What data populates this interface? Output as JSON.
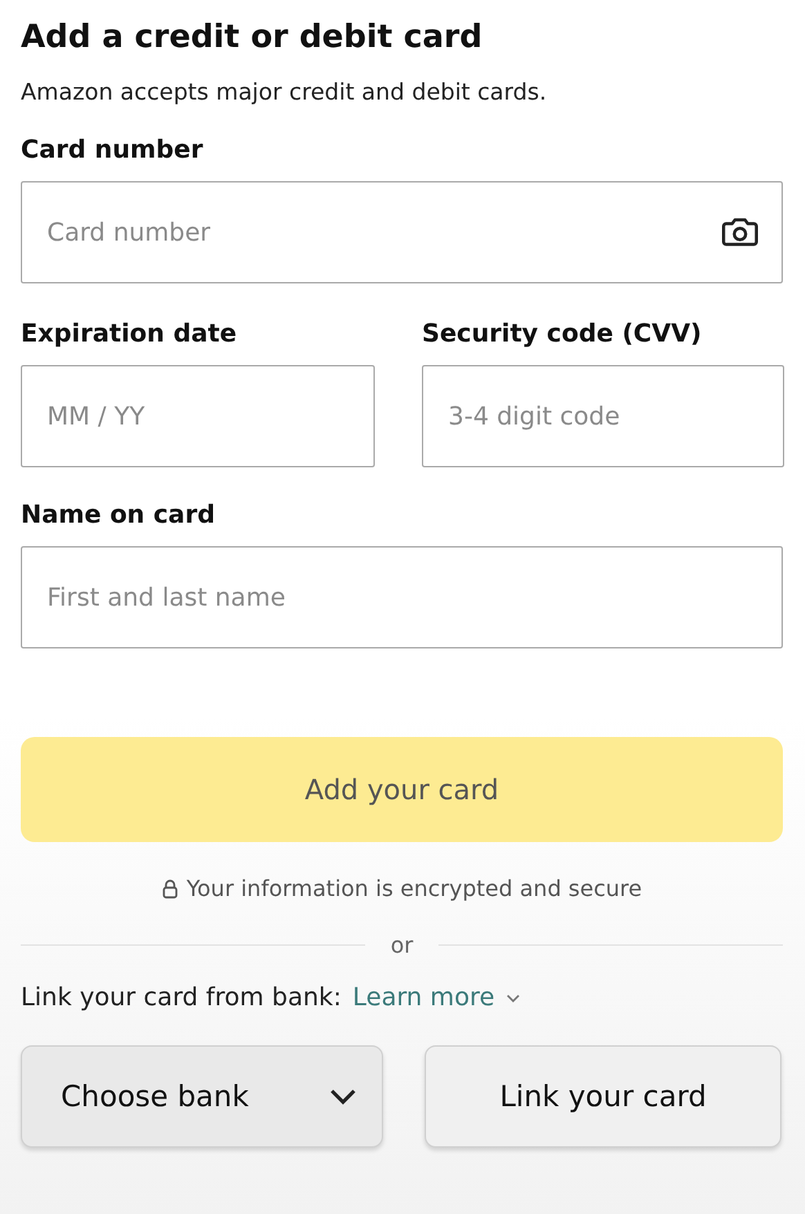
{
  "title": "Add a credit or debit card",
  "subtitle": "Amazon accepts major credit and debit cards.",
  "fields": [
    {
      "kind": "camera",
      "label": "Card number",
      "placeholder": "Card number"
    },
    {
      "kind": "plain",
      "label": "Expiration date",
      "placeholder": "MM / YY"
    },
    {
      "kind": "plain",
      "label": "Security code (CVV)",
      "placeholder": "3-4 digit code"
    },
    {
      "kind": "plain",
      "label": "Name on card",
      "placeholder": "First and last name"
    }
  ],
  "submit": {
    "label": "Add your card",
    "disabled": true
  },
  "secure_note": "Your information is encrypted and secure",
  "divider": "or",
  "bank": {
    "prompt": "Link your card from bank:",
    "link": "Learn more",
    "select": "Choose bank",
    "button": "Link your card"
  }
}
